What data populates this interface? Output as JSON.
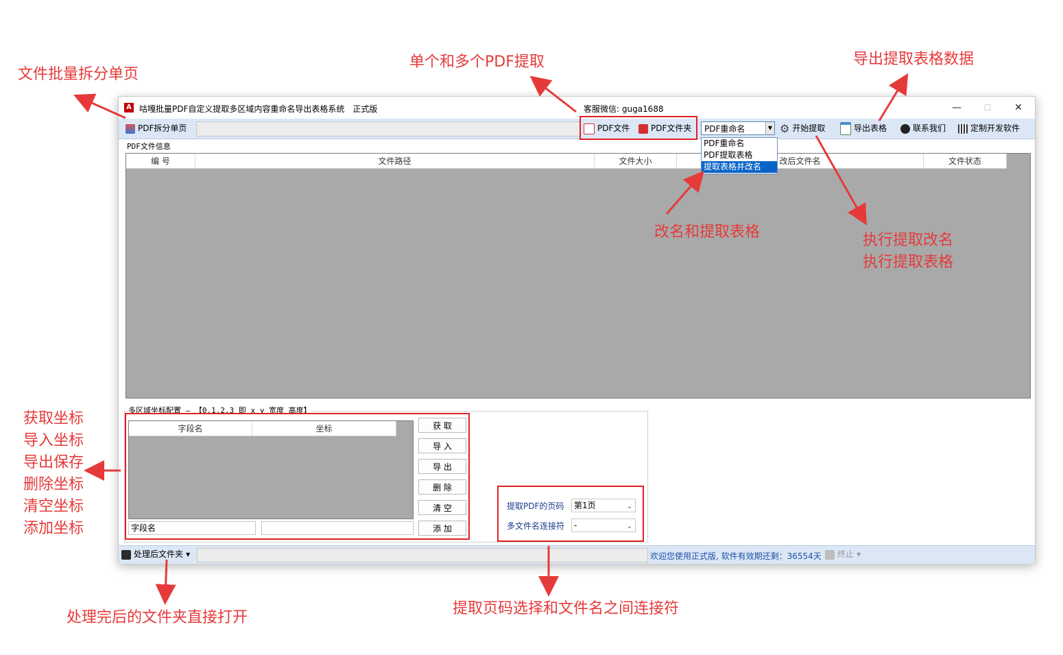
{
  "window": {
    "title": "咕嘎批量PDF自定义提取多区域内容重命名导出表格系统　正式版",
    "wechat": "客服微信: guga1688",
    "controls": {
      "minimize": "—",
      "maximize": "☐",
      "close": "✕"
    }
  },
  "toolbar": {
    "split_label": "PDF拆分单页",
    "pdf_file_label": "PDF文件",
    "pdf_folder_label": "PDF文件夹",
    "mode_selected": "PDF重命名",
    "mode_options": [
      "PDF重命名",
      "PDF提取表格",
      "提取表格并改名"
    ],
    "start_label": "开始提取",
    "export_label": "导出表格",
    "contact_label": "联系我们",
    "custom_label": "定制开发软件"
  },
  "file_info": {
    "group_label": "PDF文件信息",
    "columns": [
      "编 号",
      "文件路径",
      "文件大小",
      "改后文件名",
      "文件状态"
    ]
  },
  "coords": {
    "group_label": "多区域坐标配置 — 【0,1,2,3 即 x y 宽度 高度】",
    "columns": [
      "字段名",
      "坐标"
    ],
    "field_placeholder": "字段名",
    "buttons": {
      "get": "获 取",
      "import": "导 入",
      "export": "导 出",
      "delete": "删 除",
      "clear": "清 空",
      "add": "添 加"
    }
  },
  "options": {
    "page_label": "提取PDF的页码",
    "page_value": "第1页",
    "joiner_label": "多文件名连接符",
    "joiner_value": "-"
  },
  "status": {
    "folder_label": "处理后文件夹",
    "message": "欢迎您使用正式版, 软件有效期还剩：36554天",
    "stop_label": "终止"
  },
  "annotations": {
    "split": "文件批量拆分单页",
    "pdf_extract": "单个和多个PDF提取",
    "export": "导出提取表格数据",
    "rename_table": "改名和提取表格",
    "exec_rename": "执行提取改名",
    "exec_table": "执行提取表格",
    "coords_lines": [
      "获取坐标",
      "导入坐标",
      "导出保存",
      "删除坐标",
      "清空坐标",
      "添加坐标"
    ],
    "open_folder": "处理完后的文件夹直接打开",
    "page_joiner": "提取页码选择和文件名之间连接符"
  },
  "colors": {
    "annotation": "#e63a3a",
    "box": "#e31e24",
    "toolbar_bg": "#dbe7f5",
    "grid_bg": "#a9a9a9",
    "selection": "#0a64c8"
  }
}
